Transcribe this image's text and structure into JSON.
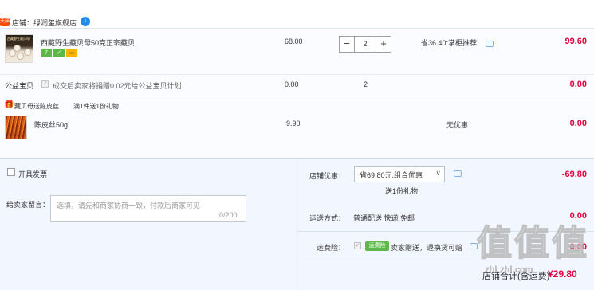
{
  "shop": {
    "badge": "天猫",
    "label": "店铺：",
    "name": "绿润玺旗舰店",
    "chat_icon": "aliwangwang-icon"
  },
  "item": {
    "thumb_text": "西藏野生蕨贝母",
    "title": "西藏野生藏贝母50克正宗藏贝...",
    "service_icons": [
      "7-day-return-icon",
      "guarantee-icon",
      "credit-card-icon"
    ],
    "service_glyphs": [
      "7",
      "✓",
      "▭"
    ],
    "unit_price": "68.00",
    "quantity": "2",
    "qty_minus": "−",
    "qty_plus": "+",
    "promo": "省36.40:掌柜推荐",
    "subtotal": "99.60"
  },
  "welfare": {
    "label": "公益宝贝",
    "text": "成交后卖家将捐赠0.02元给公益宝贝计划",
    "price": "0.00",
    "quantity": "2",
    "subtotal": "0.00"
  },
  "gift": {
    "title": "藏贝母送陈皮丝",
    "rule": "满1件送1份礼物",
    "name": "陈皮丝50g",
    "price": "9.90",
    "discount": "无优惠",
    "subtotal": "0.00"
  },
  "invoice": {
    "label": "开具发票"
  },
  "message": {
    "label": "给卖家留言：",
    "placeholder": "选填，请先和商家协商一致，付款后商家可见",
    "counter": "0/200"
  },
  "shop_discount": {
    "label": "店铺优惠：",
    "selected": "省69.80元:组合优惠",
    "gift_note": "送1份礼物",
    "amount": "-69.80"
  },
  "shipping": {
    "label": "运送方式：",
    "value": "普通配送 快递 免邮",
    "amount": "0.00"
  },
  "insurance": {
    "label": "运费险：",
    "badge": "运费险",
    "text": "卖家赠送，退换货可赔",
    "amount": "0.00"
  },
  "total": {
    "label": "店铺合计(含运费)",
    "amount": "¥29.80"
  },
  "watermark": {
    "chars": [
      "值",
      "值",
      "值"
    ],
    "url": "zhi.zhi.com"
  },
  "colors": {
    "accent_red": "#e4003a",
    "tmall_red": "#ff4a00",
    "link_blue": "#1f8dee",
    "service_green": "#5db847",
    "bottom_bg": "#f2f7ff"
  }
}
